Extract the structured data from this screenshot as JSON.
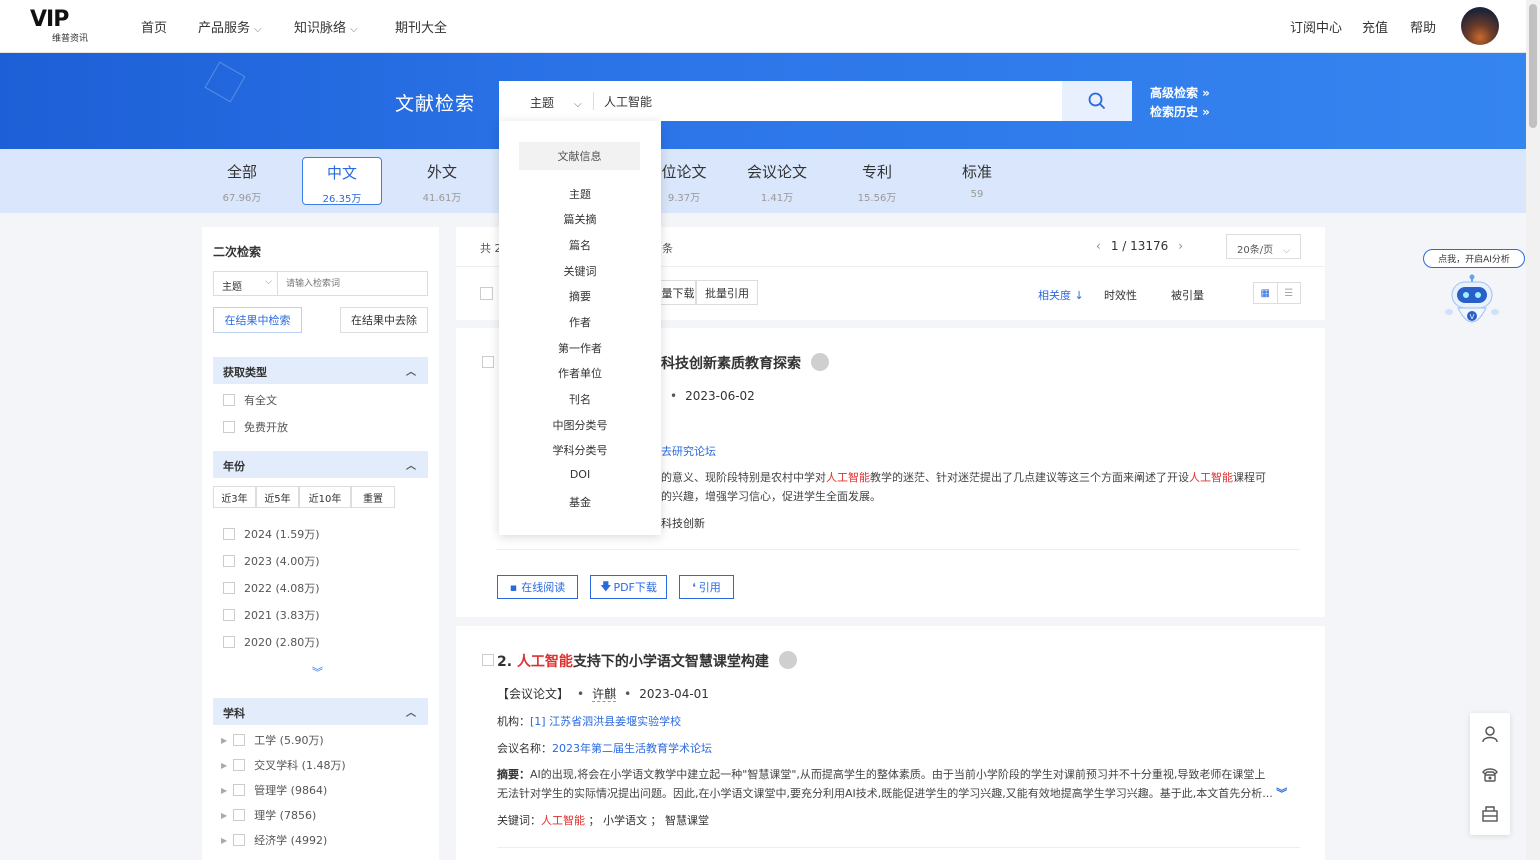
{
  "nav": {
    "logo_text": "VIP",
    "logo_sub": "维普资讯",
    "items": [
      {
        "label": "首页"
      },
      {
        "label": "产品服务"
      },
      {
        "label": "知识脉络"
      },
      {
        "label": "期刊大全"
      }
    ],
    "right": [
      "订阅中心",
      "充值",
      "帮助"
    ]
  },
  "search": {
    "title": "文献检索",
    "field": "主题",
    "query": "人工智能",
    "advanced": "高级检索 »",
    "history": "检索历史 »"
  },
  "tabs": [
    {
      "label": "全部",
      "count": "67.96万"
    },
    {
      "label": "中文",
      "count": "26.35万",
      "active": true
    },
    {
      "label": "外文",
      "count": "41.61万"
    },
    {
      "label": "位论文",
      "count": "9.37万"
    },
    {
      "label": "会议论文",
      "count": "1.41万"
    },
    {
      "label": "专利",
      "count": "15.56万"
    },
    {
      "label": "标准",
      "count": "59"
    }
  ],
  "dropdown": {
    "head": "文献信息",
    "items": [
      "主题",
      "篇关摘",
      "篇名",
      "关键词",
      "摘要",
      "作者",
      "第一作者",
      "作者单位",
      "刊名",
      "中图分类号",
      "学科分类号",
      "DOI",
      "基金"
    ]
  },
  "left": {
    "title": "二次检索",
    "field": "主题",
    "placeholder": "请输入检索词",
    "btn_in": "在结果中检索",
    "btn_out": "在结果中去除",
    "access_head": "获取类型",
    "access": [
      "有全文",
      "免费开放"
    ],
    "year_head": "年份",
    "year_btns": [
      "近3年",
      "近5年",
      "近10年",
      "重置"
    ],
    "years": [
      "2024 (1.59万)",
      "2023 (4.00万)",
      "2022 (4.08万)",
      "2021 (3.83万)",
      "2020 (2.80万)"
    ],
    "subject_head": "学科",
    "subjects": [
      "工学 (5.90万)",
      "交叉学科 (1.48万)",
      "管理学 (9864)",
      "理学 (7856)",
      "经济学 (4992)"
    ]
  },
  "toolbar": {
    "total": "共 2",
    "total_suffix": "条",
    "pager": "1 / 13176",
    "pagesize": "20条/页",
    "batch_download": "量下载",
    "batch_cite": "批量引用",
    "sort_relevance": "相关度 ↓",
    "sort_time": "时效性",
    "sort_cited": "被引量"
  },
  "result1": {
    "title": "科技创新素质教育探索",
    "date": "2023-06-02",
    "meeting": "去研究论坛",
    "abs_a": "的意义、现阶段特别是农村中学对",
    "abs_hl1": "人工智能",
    "abs_b": "教学的迷茫、针对迷茫提出了几点建议等这三个方面来阐述了开设",
    "abs_hl2": "人工智能",
    "abs_c": "课程可",
    "abs_line2": "的兴趣，增强学习信心，促进学生全面发展。",
    "kw": "科技创新",
    "btn_read": "在线阅读",
    "btn_pdf": "PDF下载",
    "btn_cite": "引用"
  },
  "result2": {
    "index": "2.",
    "title_hl": "人工智能",
    "title_rest": "支持下的小学语文智慧课堂构建",
    "type": "【会议论文】",
    "author": "许麒",
    "date": "2023-04-01",
    "org_label": "机构：",
    "org": "[1] 江苏省泗洪县姜堰实验学校",
    "meeting_label": "会议名称：",
    "meeting": "2023年第二届生活教育学术论坛",
    "abs_label": "摘要：",
    "abs_line1": "AI的出现,将会在小学语文教学中建立起一种\"智慧课堂\",从而提高学生的整体素质。由于当前小学阶段的学生对课前预习并不十分重视,导致老师在课堂上",
    "abs_line2": "无法针对学生的实际情况提出问题。因此,在小学语文课堂中,要充分利用AI技术,既能促进学生的学习兴趣,又能有效地提高学生学习兴趣。基于此,本文首先分析...",
    "kw_label": "关键词：",
    "kw1": "人工智能",
    "kw2": "小学语文",
    "kw3": "智慧课堂"
  },
  "ai": {
    "bubble": "点我，开启AI分析"
  },
  "colors": {
    "primary": "#2a6ae0",
    "hero": "#2b74e8",
    "highlight": "#e03030"
  }
}
